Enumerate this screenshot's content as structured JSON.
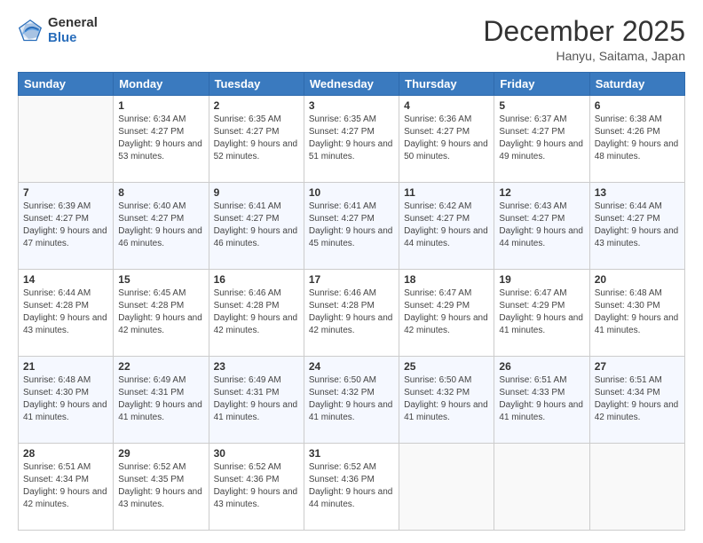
{
  "logo": {
    "general": "General",
    "blue": "Blue"
  },
  "header": {
    "month": "December 2025",
    "location": "Hanyu, Saitama, Japan"
  },
  "weekdays": [
    "Sunday",
    "Monday",
    "Tuesday",
    "Wednesday",
    "Thursday",
    "Friday",
    "Saturday"
  ],
  "weeks": [
    [
      {
        "day": "",
        "sunrise": "",
        "sunset": "",
        "daylight": ""
      },
      {
        "day": "1",
        "sunrise": "6:34 AM",
        "sunset": "4:27 PM",
        "daylight": "9 hours and 53 minutes."
      },
      {
        "day": "2",
        "sunrise": "6:35 AM",
        "sunset": "4:27 PM",
        "daylight": "9 hours and 52 minutes."
      },
      {
        "day": "3",
        "sunrise": "6:35 AM",
        "sunset": "4:27 PM",
        "daylight": "9 hours and 51 minutes."
      },
      {
        "day": "4",
        "sunrise": "6:36 AM",
        "sunset": "4:27 PM",
        "daylight": "9 hours and 50 minutes."
      },
      {
        "day": "5",
        "sunrise": "6:37 AM",
        "sunset": "4:27 PM",
        "daylight": "9 hours and 49 minutes."
      },
      {
        "day": "6",
        "sunrise": "6:38 AM",
        "sunset": "4:26 PM",
        "daylight": "9 hours and 48 minutes."
      }
    ],
    [
      {
        "day": "7",
        "sunrise": "6:39 AM",
        "sunset": "4:27 PM",
        "daylight": "9 hours and 47 minutes."
      },
      {
        "day": "8",
        "sunrise": "6:40 AM",
        "sunset": "4:27 PM",
        "daylight": "9 hours and 46 minutes."
      },
      {
        "day": "9",
        "sunrise": "6:41 AM",
        "sunset": "4:27 PM",
        "daylight": "9 hours and 46 minutes."
      },
      {
        "day": "10",
        "sunrise": "6:41 AM",
        "sunset": "4:27 PM",
        "daylight": "9 hours and 45 minutes."
      },
      {
        "day": "11",
        "sunrise": "6:42 AM",
        "sunset": "4:27 PM",
        "daylight": "9 hours and 44 minutes."
      },
      {
        "day": "12",
        "sunrise": "6:43 AM",
        "sunset": "4:27 PM",
        "daylight": "9 hours and 44 minutes."
      },
      {
        "day": "13",
        "sunrise": "6:44 AM",
        "sunset": "4:27 PM",
        "daylight": "9 hours and 43 minutes."
      }
    ],
    [
      {
        "day": "14",
        "sunrise": "6:44 AM",
        "sunset": "4:28 PM",
        "daylight": "9 hours and 43 minutes."
      },
      {
        "day": "15",
        "sunrise": "6:45 AM",
        "sunset": "4:28 PM",
        "daylight": "9 hours and 42 minutes."
      },
      {
        "day": "16",
        "sunrise": "6:46 AM",
        "sunset": "4:28 PM",
        "daylight": "9 hours and 42 minutes."
      },
      {
        "day": "17",
        "sunrise": "6:46 AM",
        "sunset": "4:28 PM",
        "daylight": "9 hours and 42 minutes."
      },
      {
        "day": "18",
        "sunrise": "6:47 AM",
        "sunset": "4:29 PM",
        "daylight": "9 hours and 42 minutes."
      },
      {
        "day": "19",
        "sunrise": "6:47 AM",
        "sunset": "4:29 PM",
        "daylight": "9 hours and 41 minutes."
      },
      {
        "day": "20",
        "sunrise": "6:48 AM",
        "sunset": "4:30 PM",
        "daylight": "9 hours and 41 minutes."
      }
    ],
    [
      {
        "day": "21",
        "sunrise": "6:48 AM",
        "sunset": "4:30 PM",
        "daylight": "9 hours and 41 minutes."
      },
      {
        "day": "22",
        "sunrise": "6:49 AM",
        "sunset": "4:31 PM",
        "daylight": "9 hours and 41 minutes."
      },
      {
        "day": "23",
        "sunrise": "6:49 AM",
        "sunset": "4:31 PM",
        "daylight": "9 hours and 41 minutes."
      },
      {
        "day": "24",
        "sunrise": "6:50 AM",
        "sunset": "4:32 PM",
        "daylight": "9 hours and 41 minutes."
      },
      {
        "day": "25",
        "sunrise": "6:50 AM",
        "sunset": "4:32 PM",
        "daylight": "9 hours and 41 minutes."
      },
      {
        "day": "26",
        "sunrise": "6:51 AM",
        "sunset": "4:33 PM",
        "daylight": "9 hours and 41 minutes."
      },
      {
        "day": "27",
        "sunrise": "6:51 AM",
        "sunset": "4:34 PM",
        "daylight": "9 hours and 42 minutes."
      }
    ],
    [
      {
        "day": "28",
        "sunrise": "6:51 AM",
        "sunset": "4:34 PM",
        "daylight": "9 hours and 42 minutes."
      },
      {
        "day": "29",
        "sunrise": "6:52 AM",
        "sunset": "4:35 PM",
        "daylight": "9 hours and 43 minutes."
      },
      {
        "day": "30",
        "sunrise": "6:52 AM",
        "sunset": "4:36 PM",
        "daylight": "9 hours and 43 minutes."
      },
      {
        "day": "31",
        "sunrise": "6:52 AM",
        "sunset": "4:36 PM",
        "daylight": "9 hours and 44 minutes."
      },
      {
        "day": "",
        "sunrise": "",
        "sunset": "",
        "daylight": ""
      },
      {
        "day": "",
        "sunrise": "",
        "sunset": "",
        "daylight": ""
      },
      {
        "day": "",
        "sunrise": "",
        "sunset": "",
        "daylight": ""
      }
    ]
  ],
  "labels": {
    "sunrise": "Sunrise:",
    "sunset": "Sunset:",
    "daylight": "Daylight:"
  }
}
